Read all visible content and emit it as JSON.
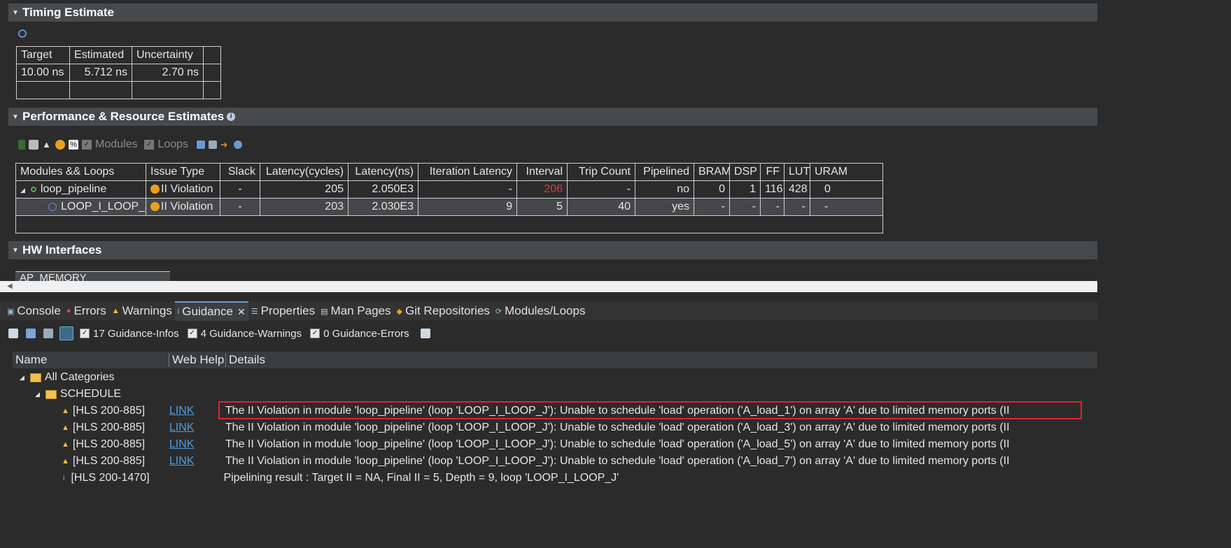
{
  "sections": {
    "timing": {
      "title": "Timing Estimate"
    },
    "perf": {
      "title": "Performance & Resource Estimates"
    },
    "hw": {
      "title": "HW Interfaces"
    }
  },
  "timing_table": {
    "headers": [
      "Target",
      "Estimated",
      "Uncertainty"
    ],
    "row": [
      "10.00 ns",
      "5.712 ns",
      "2.70 ns"
    ]
  },
  "perf_toolbar": {
    "modules_label": "Modules",
    "loops_label": "Loops"
  },
  "perf_table": {
    "headers": [
      "Modules && Loops",
      "Issue Type",
      "Slack",
      "Latency(cycles)",
      "Latency(ns)",
      "Iteration Latency",
      "Interval",
      "Trip Count",
      "Pipelined",
      "BRAM",
      "DSP",
      "FF",
      "LUT",
      "URAM"
    ],
    "rows": [
      {
        "name": "loop_pipeline",
        "issue": "II Violation",
        "slack": "-",
        "lat_cycles": "205",
        "lat_ns": "2.050E3",
        "iter_lat": "-",
        "interval": "206",
        "trip": "-",
        "pipelined": "no",
        "bram": "0",
        "dsp": "1",
        "ff": "116",
        "lut": "428",
        "uram": "0"
      },
      {
        "name": "LOOP_I_LOOP_J",
        "issue": "II Violation",
        "slack": "-",
        "lat_cycles": "203",
        "lat_ns": "2.030E3",
        "iter_lat": "9",
        "interval": "5",
        "trip": "40",
        "pipelined": "yes",
        "bram": "-",
        "dsp": "-",
        "ff": "-",
        "lut": "-",
        "uram": "-"
      }
    ]
  },
  "hw_interface_label": "AP_MEMORY",
  "tabs": [
    {
      "label": "Console"
    },
    {
      "label": "Errors"
    },
    {
      "label": "Warnings"
    },
    {
      "label": "Guidance"
    },
    {
      "label": "Properties"
    },
    {
      "label": "Man Pages"
    },
    {
      "label": "Git Repositories"
    },
    {
      "label": "Modules/Loops"
    }
  ],
  "guidance_toolbar": {
    "infos": "17 Guidance-Infos",
    "warnings": "4 Guidance-Warnings",
    "errors": "0 Guidance-Errors"
  },
  "guidance_table": {
    "headers": [
      "Name",
      "Web Help",
      "Details"
    ],
    "all_categories": "All Categories",
    "schedule": "SCHEDULE",
    "rows": [
      {
        "id": "[HLS 200-885]",
        "link": "LINK",
        "detail": "The II Violation in module 'loop_pipeline' (loop 'LOOP_I_LOOP_J'): Unable to schedule 'load' operation ('A_load_1') on array 'A' due to limited memory ports (II"
      },
      {
        "id": "[HLS 200-885]",
        "link": "LINK",
        "detail": "The II Violation in module 'loop_pipeline' (loop 'LOOP_I_LOOP_J'): Unable to schedule 'load' operation ('A_load_3') on array 'A' due to limited memory ports (II"
      },
      {
        "id": "[HLS 200-885]",
        "link": "LINK",
        "detail": "The II Violation in module 'loop_pipeline' (loop 'LOOP_I_LOOP_J'): Unable to schedule 'load' operation ('A_load_5') on array 'A' due to limited memory ports (II"
      },
      {
        "id": "[HLS 200-885]",
        "link": "LINK",
        "detail": "The II Violation in module 'loop_pipeline' (loop 'LOOP_I_LOOP_J'): Unable to schedule 'load' operation ('A_load_7') on array 'A' due to limited memory ports (II"
      },
      {
        "id": "[HLS 200-1470]",
        "link": "",
        "detail": "Pipelining result : Target II = NA, Final II = 5, Depth = 9, loop 'LOOP_I_LOOP_J'"
      }
    ]
  },
  "colors": {
    "highlight_box": "#e0242c",
    "link": "#4f9de0",
    "violation": "#e83a3a"
  }
}
